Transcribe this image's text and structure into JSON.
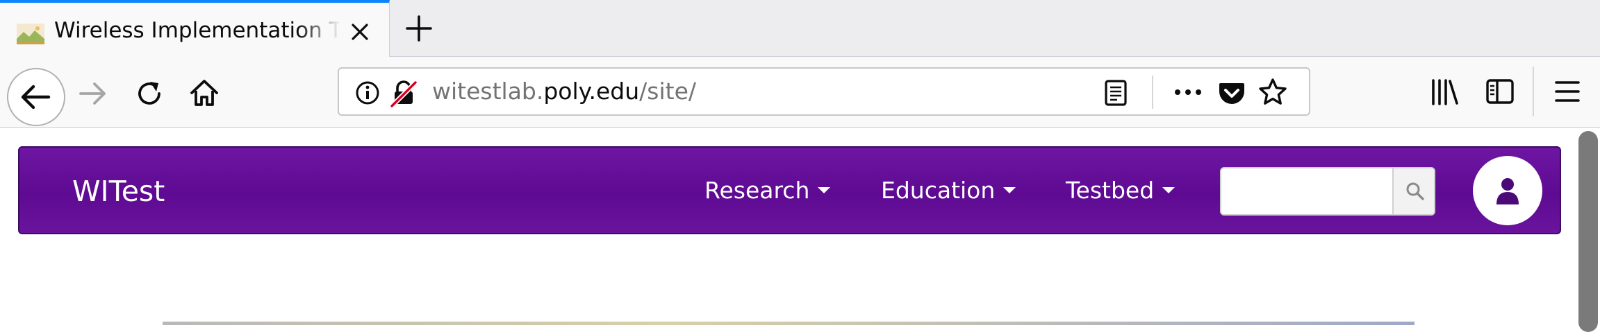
{
  "browser": {
    "tab": {
      "title": "Wireless Implementation Testbed Lab",
      "favicon": "landscape-favicon-icon"
    },
    "url": {
      "prefix": "witestlab.",
      "domain": "poly.edu",
      "path": "/site/"
    },
    "icons": {
      "back": "arrow-left-icon",
      "forward": "arrow-right-icon",
      "reload": "reload-icon",
      "home": "home-icon",
      "info": "info-icon",
      "insecure": "insecure-lock-icon",
      "reader": "reader-view-icon",
      "more": "more-actions-icon",
      "pocket": "pocket-icon",
      "bookmark": "star-icon",
      "library": "library-icon",
      "sidebar": "sidebar-icon",
      "menu": "hamburger-menu-icon"
    }
  },
  "site": {
    "brand": "WITest",
    "menu": [
      {
        "label": "Research"
      },
      {
        "label": "Education"
      },
      {
        "label": "Testbed"
      }
    ],
    "search": {
      "placeholder": "",
      "value": ""
    },
    "colors": {
      "navbar": "#5e0a92",
      "navbar_border": "#3c0a63"
    }
  }
}
